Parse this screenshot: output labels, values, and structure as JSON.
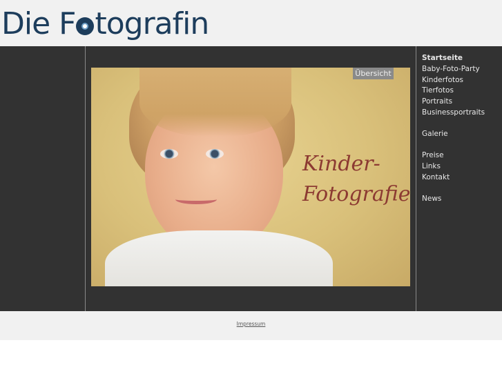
{
  "site": {
    "logo_text_left": "Die F",
    "logo_text_right": "tografin"
  },
  "hero": {
    "image_alt": "child photo",
    "text_line1": "Kinder-",
    "text_line2": "Fotografie",
    "overview_label": "Übersicht"
  },
  "nav": {
    "group1": [
      "Startseite",
      "Baby-Foto-Party",
      "Kinderfotos",
      "Tierfotos",
      "Portraits",
      "Businessportraits"
    ],
    "group2": [
      "Galerie"
    ],
    "group3": [
      "Preise",
      "Links",
      "Kontakt"
    ],
    "group4": [
      "News"
    ],
    "active": "Startseite"
  },
  "footer": {
    "impressum_label": "Impressum"
  },
  "colors": {
    "logo": "#1d3d5c",
    "main_bg": "#323232",
    "header_bg": "#f1f1f1",
    "accent_text": "#8c3a32"
  }
}
